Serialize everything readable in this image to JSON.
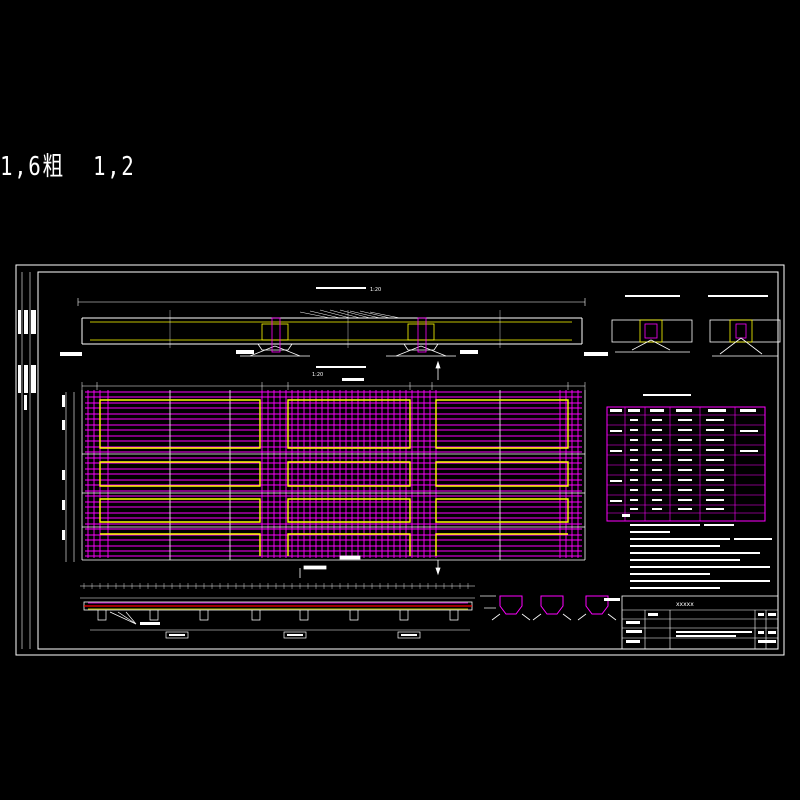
{
  "header": {
    "text": "1,6粗  1,2"
  },
  "drawing": {
    "scale_label": "1:20",
    "colors": {
      "background": "#000000",
      "frame": "#ffffff",
      "rebar": "#ff00ff",
      "stirrup": "#ffff00",
      "table_border": "#ff00ff",
      "text": "#ffffff"
    },
    "title_block": {
      "logo_text": "xxxxx"
    }
  }
}
